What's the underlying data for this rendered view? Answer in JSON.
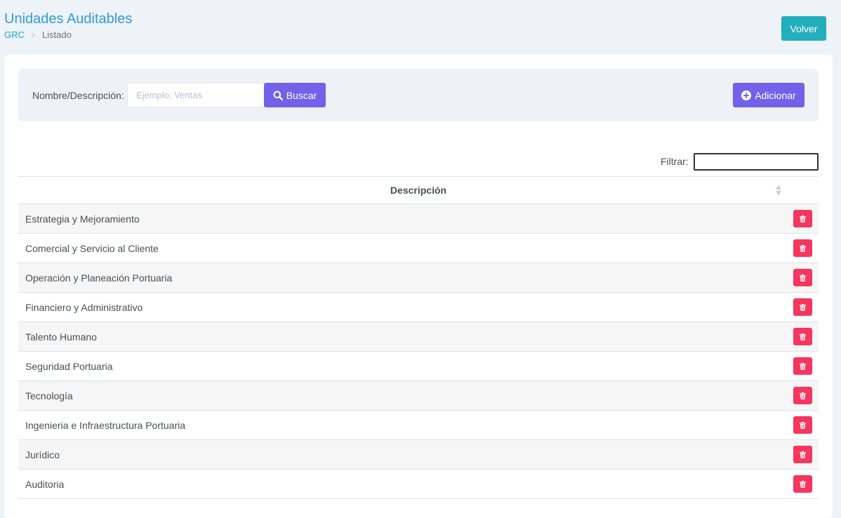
{
  "header": {
    "title": "Unidades Auditables",
    "breadcrumb": {
      "root": "GRC",
      "separator": ">",
      "current": "Listado"
    },
    "back_button": "Volver"
  },
  "search": {
    "label": "Nombre/Descripción:",
    "placeholder": "Ejemplo: Ventas",
    "value": "",
    "search_button": "Buscar",
    "add_button": "Adicionar"
  },
  "filter": {
    "label": "Filtrar:",
    "value": ""
  },
  "table": {
    "column": "Descripción",
    "rows": [
      "Estrategia y Mejoramiento",
      "Comercial y Servicio al Cliente",
      "Operación y Planeación Portuaria",
      "Financiero y Administrativo",
      "Talento Humano",
      "Seguridad Portuaria",
      "Tecnología",
      "Ingenieria e Infraestructura Portuaria",
      "Jurídico",
      "Auditoria"
    ]
  },
  "colors": {
    "title": "#3399dd",
    "volver": "#22aebb",
    "primary_purple": "#7262e9",
    "delete": "#f6365f"
  },
  "icons": {
    "search": "search-icon",
    "add": "plus-circle-icon",
    "delete": "trash-icon",
    "sort": "sort-icon",
    "breadcrumb_separator": "chevron-right-icon"
  }
}
